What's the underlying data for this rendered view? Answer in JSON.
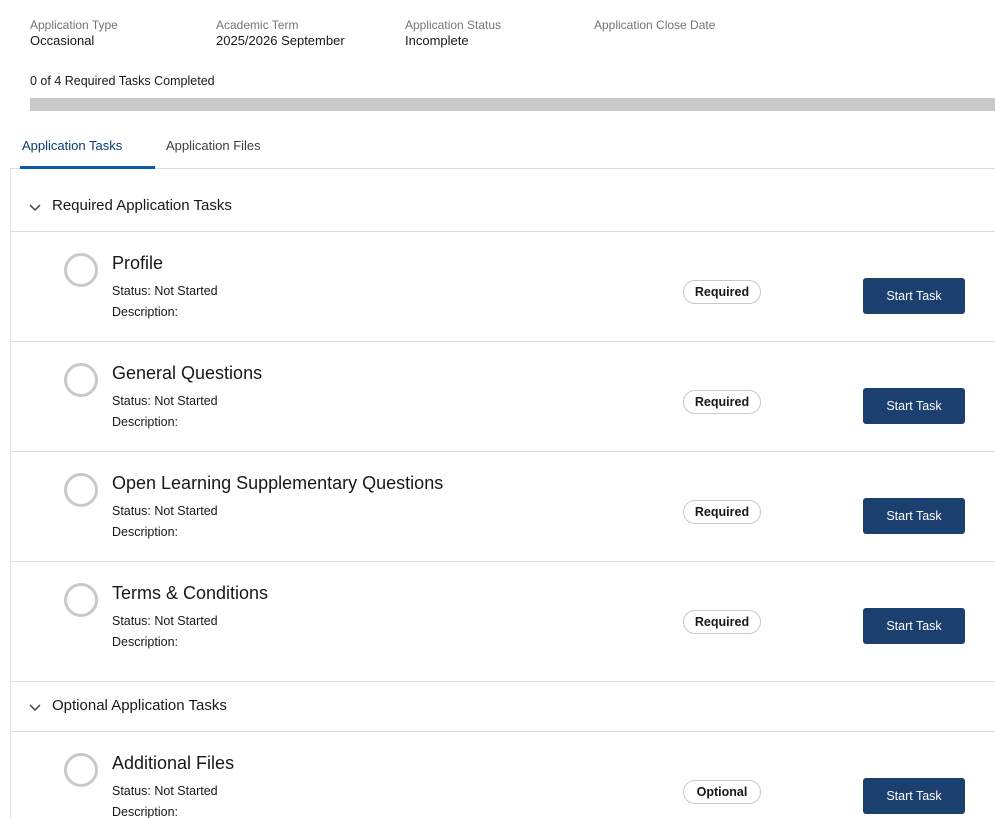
{
  "summary": {
    "fields": [
      {
        "label": "Application Type",
        "value": "Occasional"
      },
      {
        "label": "Academic Term",
        "value": "2025/2026 September"
      },
      {
        "label": "Application Status",
        "value": "Incomplete"
      },
      {
        "label": "Application Close Date",
        "value": ""
      }
    ],
    "progress_text": "0 of 4 Required Tasks Completed",
    "progress_fraction": 0
  },
  "tabs": [
    {
      "label": "Application Tasks",
      "active": true
    },
    {
      "label": "Application Files",
      "active": false
    }
  ],
  "sections": [
    {
      "title": "Required Application Tasks",
      "tasks": [
        {
          "name": "Profile",
          "status": "Status: Not Started",
          "description": "Description:",
          "badge": "Required",
          "button": "Start Task"
        },
        {
          "name": "General Questions",
          "status": "Status: Not Started",
          "description": "Description:",
          "badge": "Required",
          "button": "Start Task"
        },
        {
          "name": "Open Learning Supplementary Questions",
          "status": "Status: Not Started",
          "description": "Description:",
          "badge": "Required",
          "button": "Start Task"
        },
        {
          "name": "Terms & Conditions",
          "status": "Status: Not Started",
          "description": "Description:",
          "badge": "Required",
          "button": "Start Task"
        }
      ]
    },
    {
      "title": "Optional Application Tasks",
      "tasks": [
        {
          "name": "Additional Files",
          "status": "Status: Not Started",
          "description": "Description:",
          "badge": "Optional",
          "button": "Start Task"
        }
      ]
    }
  ],
  "colors": {
    "primary_button": "#1b3f6e",
    "active_tab": "#0b5cab",
    "progress_track": "#c9c9c9"
  }
}
